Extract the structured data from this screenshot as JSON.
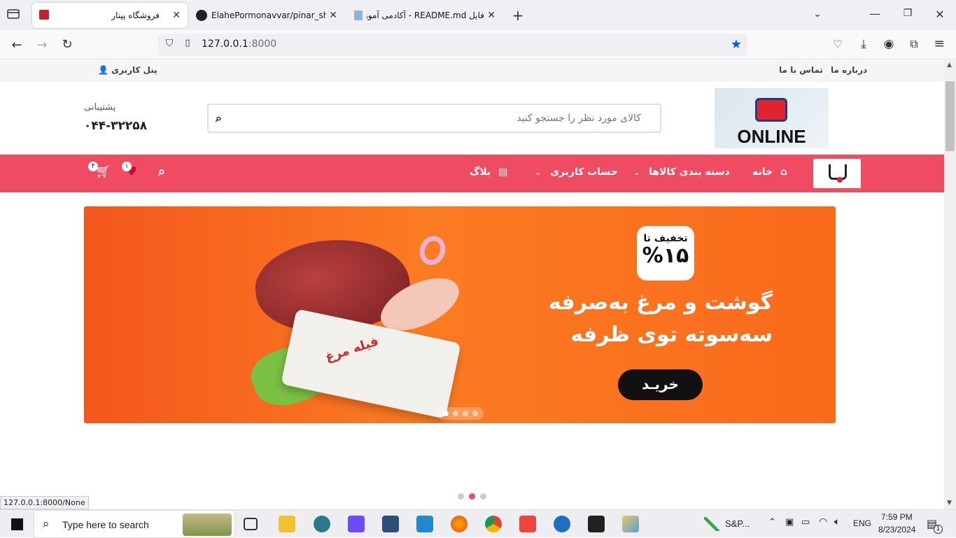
{
  "browser": {
    "tabs": [
      {
        "title": "فروشگاه پینار",
        "active": true
      },
      {
        "title": "ElahePormonavvar/pinar_shop",
        "active": false
      },
      {
        "title": "فایل README.md - آکادمی آموز",
        "active": false
      }
    ],
    "url_host": "127.0.0.1",
    "url_port": ":8000",
    "status_url": "127.0.0.1:8000/None"
  },
  "site": {
    "top_links": {
      "about": "درباره ما",
      "contact": "تماس با ما",
      "user_panel": "پنل کاربری"
    },
    "logo_text": "ONLINE",
    "search_placeholder": "کالای مورد نظر را جستجو کنید",
    "support_label": "پشتیبانی",
    "support_phone": "۰۴۴-۳۲۲۵۸",
    "menu": {
      "home": "خانه",
      "categories": "دسته بندی کالاها",
      "account": "حساب کاربری",
      "blog": "بلاگ"
    },
    "wishlist_count": "۱",
    "cart_count": "۴",
    "banner": {
      "discount_label": "تخفیف تا",
      "discount_value": "%۱۵",
      "line1": "گوشت و مرغ به‌صرفه",
      "line2": "سه‌سوته توی ظرفه",
      "buy_button": "خریـد",
      "package_label": "فیله مرغ",
      "slide_count": 4,
      "active_slide": 0
    },
    "second_slider": {
      "slide_count": 3,
      "active_slide": 1
    }
  },
  "taskbar": {
    "search_placeholder": "Type here to search",
    "stocks": "S&P...",
    "lang": "ENG",
    "time": "7:59 PM",
    "date": "8/23/2024",
    "notification_count": "1"
  },
  "colors": {
    "brand_red": "#ef4b63",
    "banner_orange": "#fa6a1b"
  }
}
